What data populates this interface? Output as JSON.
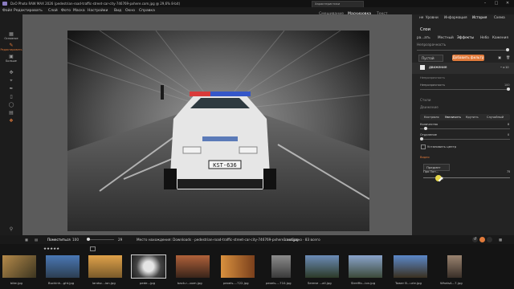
{
  "window": {
    "title": "DxO Photo RAW MAX 2026 (pedestrian-road-traffic-street-car-city-746769-pxhere.com.jpg @ 29,6% 8-bit)",
    "minimize_icon": "minimize-icon",
    "maximize_icon": "maximize-icon",
    "close_icon": "close-icon"
  },
  "menubar": {
    "items": [
      "Файл",
      "Редактировать",
      "Слой",
      "Фото",
      "Маска",
      "Настройки",
      "Вид",
      "Окно",
      "Справка"
    ]
  },
  "floating_hint": "Характеристики",
  "mode_switch": {
    "items": [
      "Смешивание",
      "Маскировка",
      "Текст"
    ],
    "active": "Маскировка"
  },
  "left_toolbar": {
    "labels": [
      "Основное",
      "Редактировать",
      "Больше"
    ]
  },
  "panel_tabs": [
    "не",
    "Уровни",
    "Информация",
    "История",
    "Схема"
  ],
  "panel_tabs_active": "История",
  "right_panel": {
    "title": "Слои",
    "subtabs": [
      "ра...ать",
      "Местный",
      "Эффекты",
      "Небо",
      "Кажения"
    ],
    "subtabs_active": "Эффекты",
    "opacity_label": "Непрозрачность",
    "empty_button": "Пустой",
    "add_filter_button": "Добавить фильтр",
    "layer_name": "движение",
    "layer_value": "• к:10",
    "section_transparency": "Непрозрачность",
    "opacity_value": "100",
    "styles_label": "Стили",
    "motion_label": "Движение",
    "mode_options": [
      "Кастрюля",
      "Увеличить",
      "Крутить",
      "Случайный"
    ],
    "mode_active": "Увеличить",
    "amount_label": "Количество",
    "amount_value": "8",
    "distance_label": "Отдаление",
    "distance_value": "0",
    "set_center_label": "Установить центр",
    "blending_label": "Видео",
    "preset_dropdown": "Предмет",
    "protect_label": "Про Поп...",
    "protect_value": "75"
  },
  "bottombar": {
    "fit_label": "Поместиться",
    "zoom_value": "100",
    "zoom_max": "29",
    "location_text": "Место нахождения: Downloads · pedestrian-road-traffic-street-car-city-746769-pxhere.com.jpg",
    "selection_text": "1 выбрано · 83 всего",
    "rating": "★★★★★"
  },
  "filmstrip": {
    "items": [
      {
        "label": "bike.jpg",
        "color": "#7b6a4a"
      },
      {
        "label": "Buckinh...ght.jpg",
        "color": "#2f5a8a"
      },
      {
        "label": "landsc...ion.jpg",
        "color": "#b07a3a"
      },
      {
        "label": "pede...jpg",
        "color": "#3c3c3c",
        "selected": true
      },
      {
        "label": "back-r...oom.jpg",
        "color": "#8a4d2e"
      },
      {
        "label": "pexels-...722.jpg",
        "color": "#c27d40"
      },
      {
        "label": "pexels-...710.jpg",
        "color": "#5a5a5a"
      },
      {
        "label": "Serene ...all.jpg",
        "color": "#3f5a7a"
      },
      {
        "label": "Streiffo...ion.jpg",
        "color": "#5b6c85"
      },
      {
        "label": "Tower B...urie.jpg",
        "color": "#4d6f9e"
      },
      {
        "label": "WhatsA...7.jpg",
        "color": "#6c5a4b"
      }
    ]
  }
}
